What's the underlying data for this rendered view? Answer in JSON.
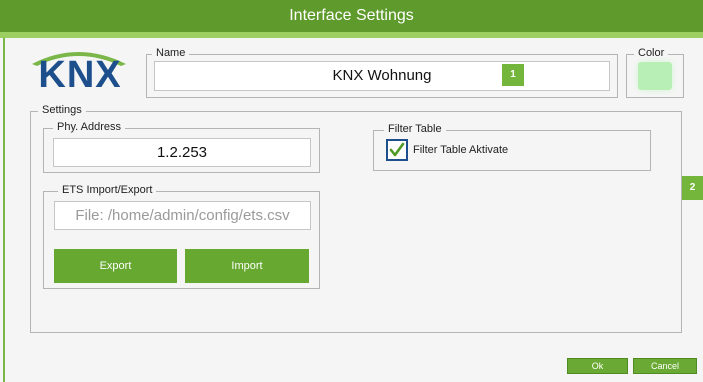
{
  "window": {
    "title": "Interface Settings"
  },
  "logo": {
    "text": "KNX"
  },
  "name_group": {
    "legend": "Name",
    "value": "KNX Wohnung",
    "badge": "1"
  },
  "color_group": {
    "legend": "Color",
    "swatch": "#b7efb7"
  },
  "settings": {
    "legend": "Settings",
    "badge": "2",
    "phy_address": {
      "legend": "Phy. Address",
      "value": "1.2.253"
    },
    "filter_table": {
      "legend": "Filter Table",
      "checkbox_label": "Filter Table Aktivate",
      "checked": true
    },
    "ets": {
      "legend": "ETS Import/Export",
      "placeholder": "File: /home/admin/config/ets.csv",
      "export_label": "Export",
      "import_label": "Import"
    }
  },
  "footer": {
    "ok_label": "Ok",
    "cancel_label": "Cancel"
  },
  "colors": {
    "title_bar": "#5f9a2c",
    "accent": "#66a830",
    "logo_blue": "#1c4f8c",
    "logo_green": "#7ab648"
  }
}
